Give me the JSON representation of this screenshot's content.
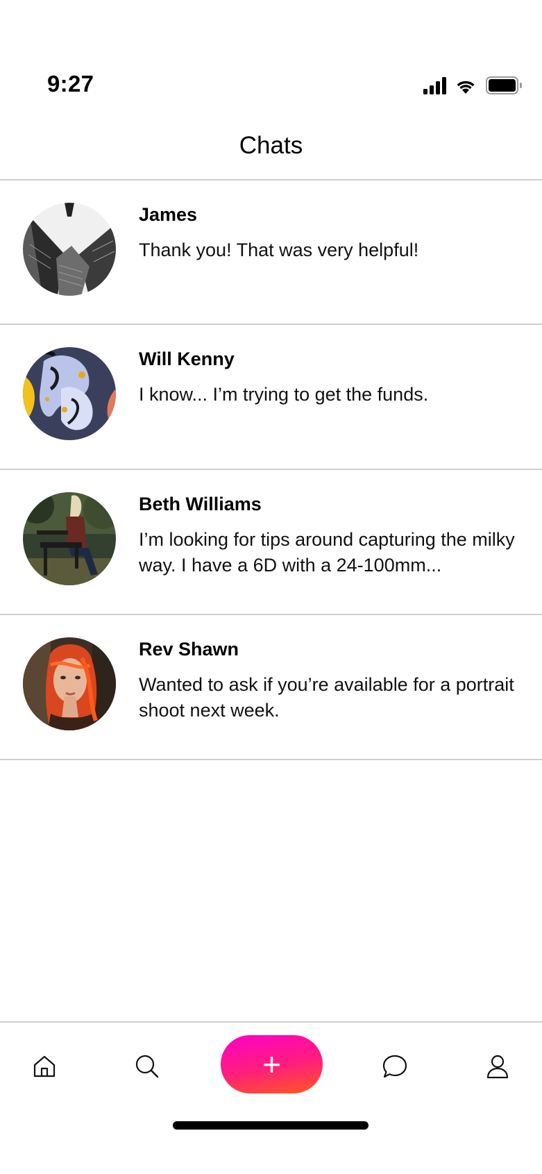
{
  "status_bar": {
    "time": "9:27",
    "icons": [
      "signal-icon",
      "wifi-icon",
      "battery-icon"
    ]
  },
  "header": {
    "title": "Chats"
  },
  "chats": [
    {
      "name": "James",
      "message": "Thank you! That was very helpful!",
      "avatar": "skyscrapers-photo"
    },
    {
      "name": "Will Kenny",
      "message": "I know... I’m trying to get the funds.",
      "avatar": "abstract-paint-photo"
    },
    {
      "name": "Beth Williams",
      "message": "I’m looking for tips around capturing the milky way. I have a 6D with a 24-100mm...",
      "avatar": "woman-on-bench-photo"
    },
    {
      "name": "Rev Shawn",
      "message": "Wanted to ask if you’re available for a portrait shoot next week.",
      "avatar": "red-hair-portrait-photo"
    }
  ],
  "tab_bar": {
    "items": [
      "home-icon",
      "search-icon",
      "compose-button",
      "chat-icon",
      "profile-icon"
    ],
    "compose_label": "+",
    "compose_gradient": [
      "#ff00c8",
      "#ff1f7a",
      "#ff5a1f"
    ]
  },
  "colors": {
    "divider": "#cfcfcf",
    "background": "#ffffff",
    "text": "#000000"
  }
}
